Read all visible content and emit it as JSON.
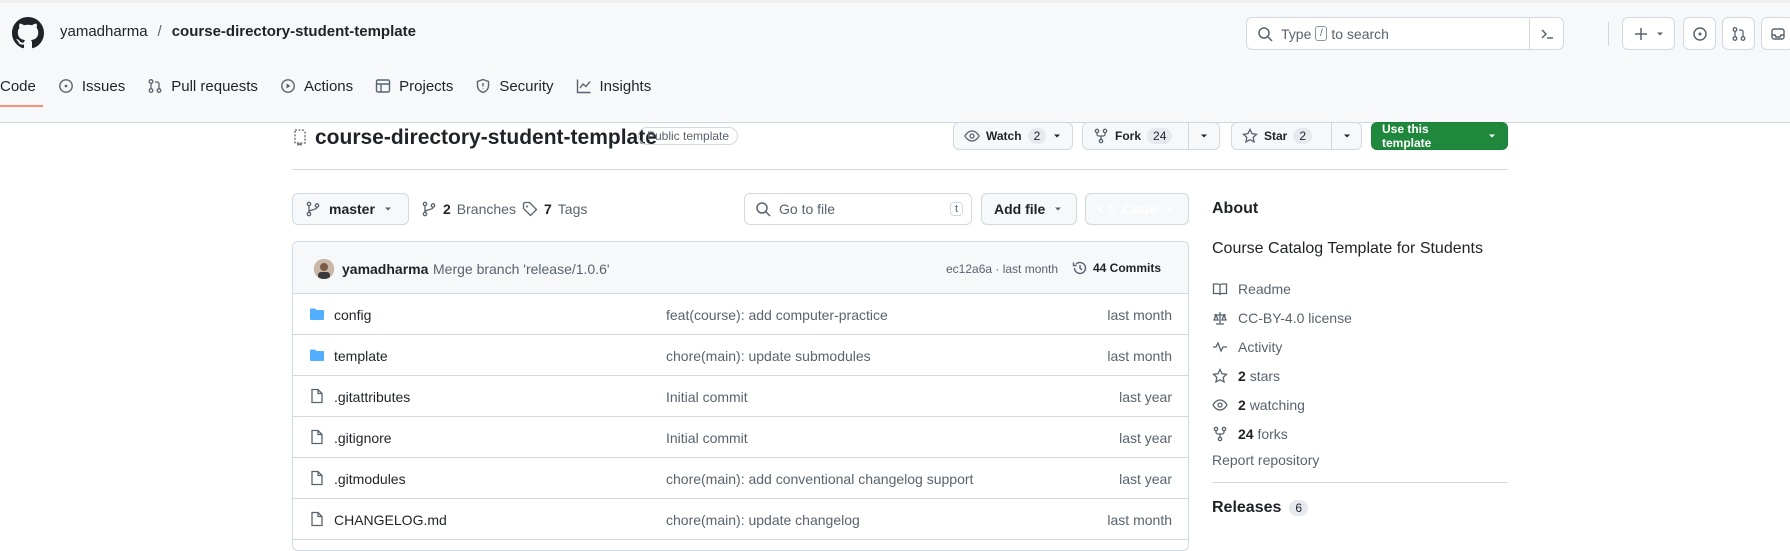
{
  "header": {
    "owner": "yamadharma",
    "separator": "/",
    "repo": "course-directory-student-template",
    "search_text": "Type",
    "search_key": "/",
    "search_suffix": "to search"
  },
  "nav": {
    "code": "Code",
    "issues": "Issues",
    "pulls": "Pull requests",
    "actions": "Actions",
    "projects": "Projects",
    "security": "Security",
    "insights": "Insights"
  },
  "repo": {
    "name": "course-directory-student-template",
    "badge": "Public template",
    "watch_label": "Watch",
    "watch_count": "2",
    "fork_label": "Fork",
    "fork_count": "24",
    "star_label": "Star",
    "star_count": "2",
    "use_template": "Use this template"
  },
  "toolbar": {
    "branch": "master",
    "branches_count": "2",
    "branches_label": "Branches",
    "tags_count": "7",
    "tags_label": "Tags",
    "goto_placeholder": "Go to file",
    "goto_key": "t",
    "add_file": "Add file",
    "code_button": "Code"
  },
  "commit": {
    "user": "yamadharma",
    "message": "Merge branch 'release/1.0.6'",
    "hash": "ec12a6a · last month",
    "commits": "44 Commits"
  },
  "files": [
    {
      "name": "config",
      "type": "folder",
      "message": "feat(course): add computer-practice",
      "age": "last month"
    },
    {
      "name": "template",
      "type": "folder",
      "message": "chore(main): update submodules",
      "age": "last month"
    },
    {
      "name": ".gitattributes",
      "type": "file",
      "message": "Initial commit",
      "age": "last year"
    },
    {
      "name": ".gitignore",
      "type": "file",
      "message": "Initial commit",
      "age": "last year"
    },
    {
      "name": ".gitmodules",
      "type": "file",
      "message": "chore(main): add conventional changelog support",
      "age": "last year"
    },
    {
      "name": "CHANGELOG.md",
      "type": "file",
      "message": "chore(main): update changelog",
      "age": "last month"
    }
  ],
  "about": {
    "title": "About",
    "description": "Course Catalog Template for Students",
    "readme": "Readme",
    "license": "CC-BY-4.0 license",
    "activity": "Activity",
    "stars_count": "2",
    "stars_label": "stars",
    "watching_count": "2",
    "watching_label": "watching",
    "forks_count": "24",
    "forks_label": "forks",
    "report": "Report repository",
    "releases": "Releases",
    "releases_count": "6"
  },
  "colors": {
    "accent_green": "#1f883d",
    "folder_blue": "#54aeff",
    "tab_underline": "#fd8c73"
  }
}
